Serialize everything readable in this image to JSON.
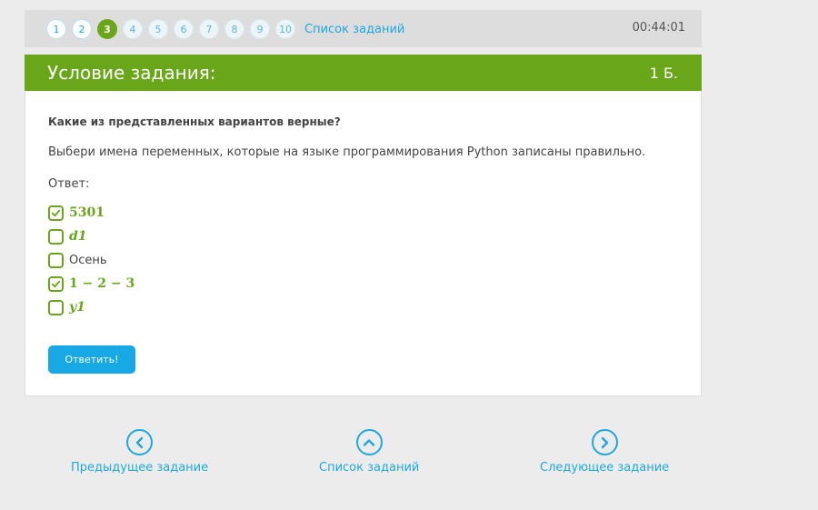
{
  "nav": {
    "pages": [
      {
        "label": "1",
        "state": "done"
      },
      {
        "label": "2",
        "state": "done"
      },
      {
        "label": "3",
        "state": "current"
      },
      {
        "label": "4",
        "state": "todo"
      },
      {
        "label": "5",
        "state": "todo"
      },
      {
        "label": "6",
        "state": "todo"
      },
      {
        "label": "7",
        "state": "todo"
      },
      {
        "label": "8",
        "state": "todo"
      },
      {
        "label": "9",
        "state": "todo"
      },
      {
        "label": "10",
        "state": "todo"
      }
    ],
    "task_list_label": "Список заданий",
    "timer": "00:44:01"
  },
  "task": {
    "header_title": "Условие задания:",
    "points": "1 Б.",
    "question": "Какие из представленных вариантов верные?",
    "instruction": "Выбери имена переменных, которые на языке программирования Python записаны правильно.",
    "answer_label": "Ответ:",
    "options": [
      {
        "label": "5301",
        "checked": true
      },
      {
        "label": "d1",
        "checked": false
      },
      {
        "label": "Осень",
        "checked": false
      },
      {
        "label": "1 − 2 − 3",
        "checked": true
      },
      {
        "label": "y1",
        "checked": false
      }
    ],
    "submit_label": "Ответить!"
  },
  "bottom_nav": {
    "prev_label": "Предыдущее задание",
    "list_label": "Список заданий",
    "next_label": "Следующее задание"
  },
  "colors": {
    "accent_green": "#6aa61a",
    "link_blue": "#1ea8e0",
    "button_blue": "#17a9e6"
  }
}
